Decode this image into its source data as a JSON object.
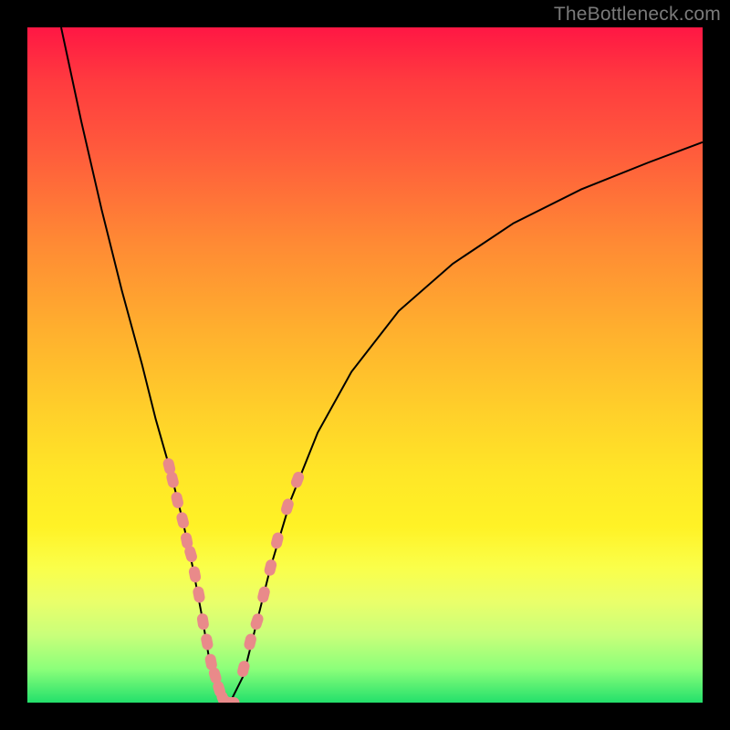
{
  "watermark": "TheBottleneck.com",
  "chart_data": {
    "type": "line",
    "title": "",
    "xlabel": "",
    "ylabel": "",
    "xlim": [
      0,
      100
    ],
    "ylim": [
      0,
      100
    ],
    "background_gradient": {
      "stops": [
        {
          "pos": 0,
          "color": "#ff1744"
        },
        {
          "pos": 8,
          "color": "#ff3b3f"
        },
        {
          "pos": 18,
          "color": "#ff5a3c"
        },
        {
          "pos": 32,
          "color": "#ff8a34"
        },
        {
          "pos": 45,
          "color": "#ffb02e"
        },
        {
          "pos": 57,
          "color": "#ffd02a"
        },
        {
          "pos": 66,
          "color": "#ffe627"
        },
        {
          "pos": 74,
          "color": "#fff226"
        },
        {
          "pos": 80,
          "color": "#faff4a"
        },
        {
          "pos": 85,
          "color": "#eaff6a"
        },
        {
          "pos": 90,
          "color": "#c9ff7a"
        },
        {
          "pos": 95,
          "color": "#8cff7a"
        },
        {
          "pos": 100,
          "color": "#23e06b"
        }
      ]
    },
    "series": [
      {
        "name": "bottleneck-curve",
        "color": "#000000",
        "x": [
          5,
          8,
          11,
          14,
          17,
          19,
          21,
          23,
          24.5,
          26,
          27,
          28,
          29,
          30,
          32,
          34,
          36,
          39,
          43,
          48,
          55,
          63,
          72,
          82,
          92,
          100
        ],
        "y": [
          100,
          86,
          73,
          61,
          50,
          42,
          35,
          27,
          20,
          12,
          6,
          2,
          0,
          0,
          4,
          12,
          20,
          30,
          40,
          49,
          58,
          65,
          71,
          76,
          80,
          83
        ]
      }
    ],
    "marker_series": [
      {
        "name": "highlight-dots-left",
        "color": "#e98a8a",
        "x": [
          21,
          21.5,
          22.2,
          23,
          23.6,
          24.2,
          24.8,
          25.4,
          26,
          26.6,
          27.2,
          27.8,
          28.4,
          29,
          29.6,
          30.2
        ],
        "y": [
          35,
          33,
          30,
          27,
          24,
          22,
          19,
          16,
          12,
          9,
          6,
          4,
          2,
          0.5,
          0,
          0
        ]
      },
      {
        "name": "highlight-dots-right",
        "color": "#e98a8a",
        "x": [
          32,
          33,
          34,
          35,
          36,
          37,
          38.5,
          40
        ],
        "y": [
          5,
          9,
          12,
          16,
          20,
          24,
          29,
          33
        ]
      }
    ]
  }
}
